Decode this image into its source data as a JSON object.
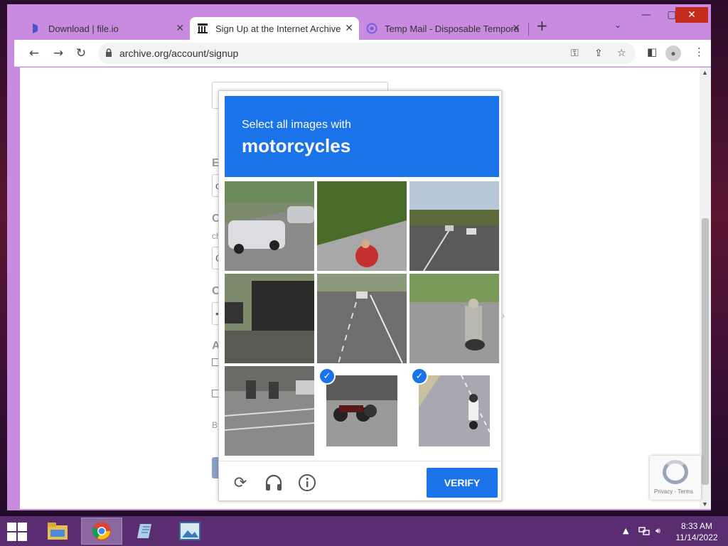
{
  "window": {
    "controls": {
      "minimize": "—",
      "maximize": "▢",
      "close": "✕"
    },
    "tabs": [
      {
        "label": "Download | file.io",
        "icon": "fileio-icon"
      },
      {
        "label": "Sign Up at the Internet Archive",
        "icon": "internet-archive-icon",
        "active": true
      },
      {
        "label": "Temp Mail - Disposable Tempora",
        "icon": "tempmail-icon"
      }
    ],
    "new_tab": "+",
    "tab_search": "⌄"
  },
  "toolbar": {
    "url": "archive.org/account/signup"
  },
  "page": {
    "letters": [
      "E",
      "C",
      "C",
      "A"
    ],
    "small_text": "ch",
    "field_values": [
      "c",
      "C",
      "•"
    ],
    "footer_text": "By"
  },
  "captcha": {
    "instruction": "Select all images with",
    "target": "motorcycles",
    "tiles": [
      {
        "scene": "cars on street",
        "selected": false
      },
      {
        "scene": "person on grass",
        "selected": false
      },
      {
        "scene": "highway traffic",
        "selected": false
      },
      {
        "scene": "bus on street",
        "selected": false
      },
      {
        "scene": "cars on road",
        "selected": false
      },
      {
        "scene": "motorcycle rider on road",
        "selected": false
      },
      {
        "scene": "scooters at crossing",
        "selected": false
      },
      {
        "scene": "parked motorcycle",
        "selected": true
      },
      {
        "scene": "motorcyclist on road",
        "selected": true
      }
    ],
    "verify_label": "VERIFY",
    "icons": [
      "reload-icon",
      "headphones-icon",
      "info-icon"
    ]
  },
  "recaptcha_badge": {
    "text": "Privacy - Terms"
  },
  "taskbar": {
    "apps": [
      "file-explorer-icon",
      "chrome-icon",
      "notepad-icon",
      "photos-icon"
    ],
    "time": "8:33 AM",
    "date": "11/14/2022"
  },
  "colors": {
    "accent": "#1a73e8",
    "titlebar": "#c98be0",
    "taskbar": "#5a2d70"
  }
}
